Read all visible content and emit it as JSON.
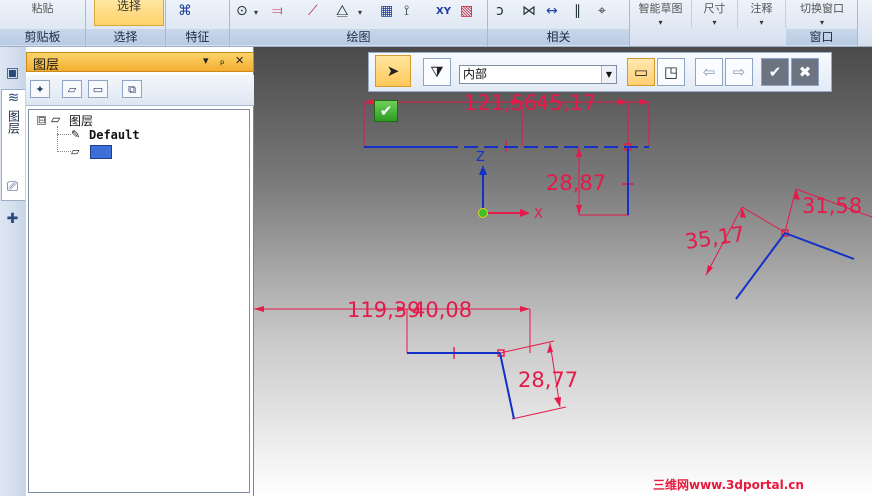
{
  "ribbon": {
    "groups": [
      {
        "id": "clipboard",
        "top_label": "粘贴",
        "label": "剪贴板"
      },
      {
        "id": "select",
        "top_label": "选择",
        "label": "选择"
      },
      {
        "id": "features",
        "label": "特征"
      },
      {
        "id": "draw",
        "label": "绘图"
      },
      {
        "id": "relations",
        "label": "相关"
      },
      {
        "id": "window",
        "label": "窗口"
      }
    ],
    "dropdowns": [
      {
        "id": "intellisketch",
        "label": "智能草图"
      },
      {
        "id": "dimension",
        "label": "尺寸"
      },
      {
        "id": "annotation",
        "label": "注释"
      },
      {
        "id": "switch-window",
        "label": "切换窗口"
      }
    ],
    "xy_label": "XY"
  },
  "side_tabs": {
    "layers_label": "图层"
  },
  "layers_panel": {
    "title": "图层",
    "title_controls": {
      "menu": "▾",
      "pin": "ₚ",
      "close": "✕"
    },
    "tree": {
      "root": "图层",
      "expander": "⊟",
      "children": [
        {
          "label": "Default"
        }
      ]
    }
  },
  "command_bar": {
    "scope_value": "内部"
  },
  "canvas": {
    "dimensions": [
      "121,56",
      "45,17",
      "28,87",
      "35,17",
      "31,58",
      "119,39",
      "40,08",
      "28,77"
    ],
    "axis_x": "X",
    "axis_z": "Z"
  },
  "watermark": "三维网www.3dportal.cn",
  "colors": {
    "dimension": "#e5194a",
    "sketch_line": "#1330c8",
    "axis_x": "#e5194a",
    "axis_z": "#1330c8",
    "origin": "#3fbf2b"
  }
}
